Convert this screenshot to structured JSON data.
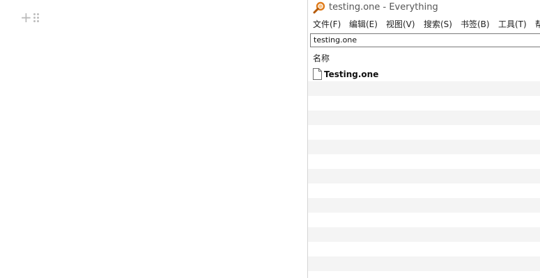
{
  "left_pane": {
    "add_block_glyph": "+"
  },
  "window": {
    "title": "testing.one - Everything",
    "menu": [
      {
        "label": "文件(F)"
      },
      {
        "label": "编辑(E)"
      },
      {
        "label": "视图(V)"
      },
      {
        "label": "搜索(S)"
      },
      {
        "label": "书签(B)"
      },
      {
        "label": "工具(T)"
      },
      {
        "label": "帮"
      }
    ],
    "search": {
      "value": "testing.one"
    },
    "columns": {
      "name": "名称"
    },
    "results": [
      {
        "name": "Testing.one",
        "icon": "file-icon"
      }
    ],
    "colors": {
      "app_icon": "#e07b1a",
      "alt_row": "#f4f4f4",
      "border": "#7a7a7a"
    }
  }
}
